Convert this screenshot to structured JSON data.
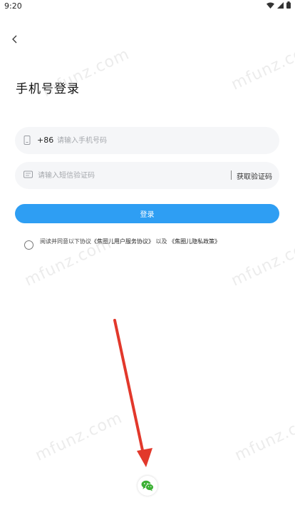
{
  "status_bar": {
    "time": "9:20"
  },
  "page": {
    "title": "手机号登录"
  },
  "phone": {
    "country_code": "+86",
    "placeholder": "请输入手机号码"
  },
  "code": {
    "placeholder": "请输入短信验证码",
    "get_code_label": "获取验证码"
  },
  "login": {
    "label": "登录"
  },
  "agreement": {
    "prefix": "阅读并同意以下协议",
    "user_agreement": "《焦圈儿用户服务协议》",
    "joiner": "以及",
    "privacy_policy": "《焦圈儿隐私政策》"
  },
  "watermark": "mfunz.com",
  "colors": {
    "accent": "#2e9ef3",
    "wechat": "#3cb034",
    "annotation_arrow": "#e2382b"
  }
}
